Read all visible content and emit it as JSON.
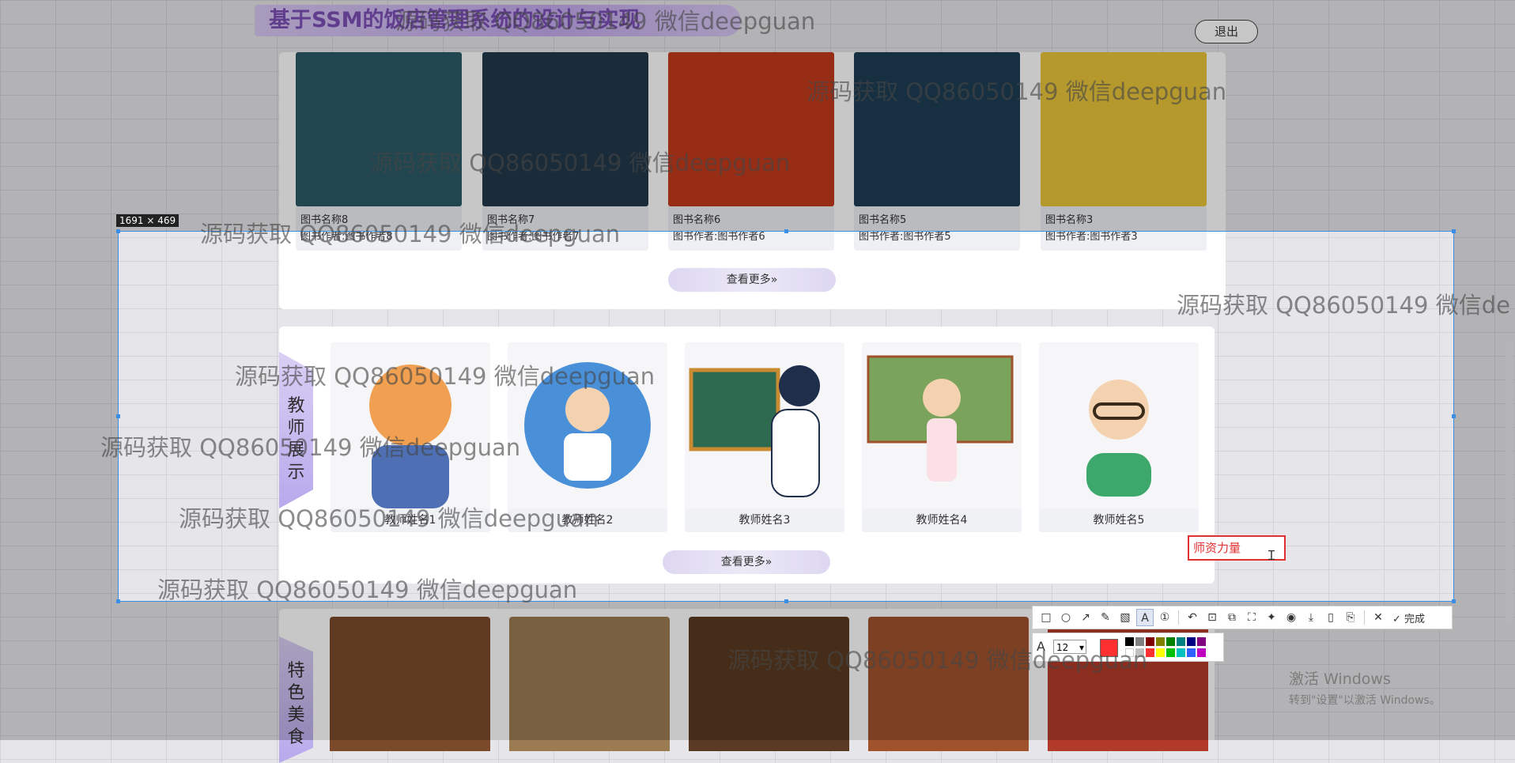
{
  "header": {
    "title": "基于SSM的饭店管理系统的设计与实现",
    "logout_label": "退出"
  },
  "books": {
    "items": [
      {
        "name": "图书名称8",
        "author": "图书作者:图书作者8",
        "cover_color": "#2b5a66"
      },
      {
        "name": "图书名称7",
        "author": "图书作者:图书作者7",
        "cover_color": "#22384a"
      },
      {
        "name": "图书名称6",
        "author": "图书作者:图书作者6",
        "cover_color": "#c23a1c"
      },
      {
        "name": "图书名称5",
        "author": "图书作者:图书作者5",
        "cover_color": "#1e3e54"
      },
      {
        "name": "图书名称3",
        "author": "图书作者:图书作者3",
        "cover_color": "#e8c43a"
      }
    ],
    "prev_arrow": "‹",
    "next_arrow": "›",
    "more_label": "查看更多»"
  },
  "teachers": {
    "section_label": "教师展示",
    "items": [
      {
        "name": "教师姓名1",
        "color": "#f0a050"
      },
      {
        "name": "教师姓名2",
        "color": "#4a90d9"
      },
      {
        "name": "教师姓名3",
        "color": "#2d6a4f"
      },
      {
        "name": "教师姓名4",
        "color": "#7aa35c"
      },
      {
        "name": "教师姓名5",
        "color": "#3da86b"
      }
    ],
    "more_label": "查看更多»"
  },
  "foods": {
    "section_label": "特色美食",
    "colors": [
      "#7a4a2a",
      "#9b7b52",
      "#5a3a22",
      "#a0522d",
      "#b23a28"
    ]
  },
  "screenshot_tool": {
    "size_label": "1691 × 469",
    "text_value": "师资力量",
    "done_label": "完成",
    "font_size": "12",
    "tools": [
      "rect-icon",
      "ellipse-icon",
      "arrow-icon",
      "pen-icon",
      "mosaic-icon",
      "text-icon",
      "number-icon",
      "undo-icon",
      "ocr-icon",
      "translate-icon",
      "scroll-capture-icon",
      "pin-icon",
      "record-icon",
      "save-icon",
      "save-as-icon",
      "bookmark-icon"
    ],
    "current_color": "#ff3030",
    "palette": [
      "#000000",
      "#808080",
      "#800000",
      "#808000",
      "#008000",
      "#008080",
      "#000080",
      "#800080",
      "#ffffff",
      "#c0c0c0",
      "#ff3030",
      "#ffff00",
      "#00c000",
      "#00c0c0",
      "#3060ff",
      "#c000c0"
    ]
  },
  "watermark_text": "源码获取 QQ86050149 微信deepguan",
  "watermark_text_partial": "源码获取 QQ86050149 微信de",
  "windows_activation": {
    "line1": "激活 Windows",
    "line2": "转到\"设置\"以激活 Windows。"
  }
}
